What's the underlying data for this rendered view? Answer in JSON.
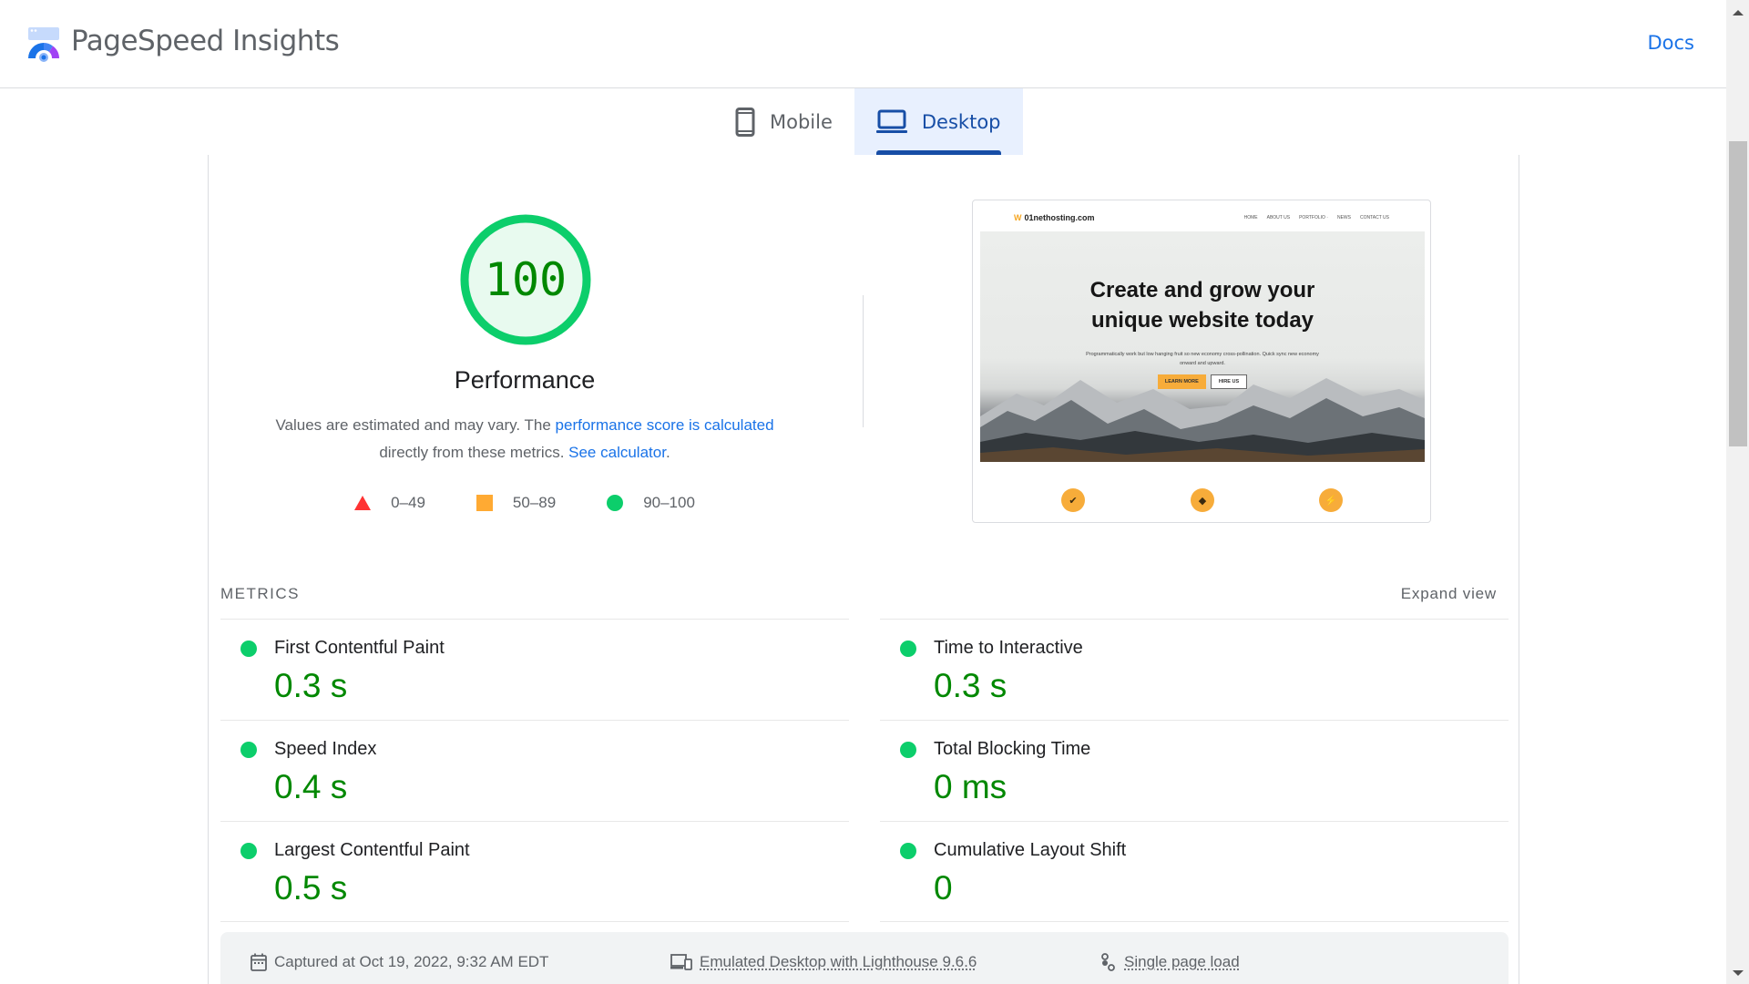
{
  "header": {
    "brand": "PageSpeed Insights",
    "docs_link": "Docs"
  },
  "tabs": [
    {
      "label": "Mobile",
      "icon": "smartphone-icon",
      "active": false
    },
    {
      "label": "Desktop",
      "icon": "laptop-icon",
      "active": true
    }
  ],
  "performance": {
    "score": "100",
    "title": "Performance",
    "desc_prefix": "Values are estimated and may vary. The ",
    "desc_link1": "performance score is calculated",
    "desc_middle": " directly from these metrics. ",
    "desc_link2": "See calculator",
    "desc_suffix": ".",
    "legend": [
      {
        "shape": "triangle",
        "label": "0–49",
        "color": "#ff3333"
      },
      {
        "shape": "square",
        "label": "50–89",
        "color": "#ffaa33"
      },
      {
        "shape": "circle",
        "label": "90–100",
        "color": "#0cce6b"
      }
    ]
  },
  "thumbnail": {
    "site_name": "01nethosting.com",
    "nav_links": [
      "HOME",
      "ABOUT US",
      "PORTFOLIO ·",
      "NEWS",
      "CONTACT US"
    ],
    "headline_line1": "Create and grow your",
    "headline_line2": "unique website today",
    "subtext": "Programmatically work but low hanging fruit so new economy cross-pollination. Quick sync new economy onward and upward.",
    "button_primary": "LEARN MORE",
    "button_secondary": "HIRE US",
    "feature_icons": [
      "✔",
      "◆",
      "⚡"
    ]
  },
  "metrics": {
    "section_label": "METRICS",
    "expand_label": "Expand view",
    "left": [
      {
        "name": "First Contentful Paint",
        "value": "0.3 s",
        "status": "good"
      },
      {
        "name": "Speed Index",
        "value": "0.4 s",
        "status": "good"
      },
      {
        "name": "Largest Contentful Paint",
        "value": "0.5 s",
        "status": "good"
      }
    ],
    "right": [
      {
        "name": "Time to Interactive",
        "value": "0.3 s",
        "status": "good"
      },
      {
        "name": "Total Blocking Time",
        "value": "0 ms",
        "status": "good"
      },
      {
        "name": "Cumulative Layout Shift",
        "value": "0",
        "status": "good"
      }
    ]
  },
  "runtime": {
    "captured": "Captured at Oct 19, 2022, 9:32 AM EDT",
    "emulated": "Emulated Desktop with Lighthouse 9.6.6",
    "load_type": "Single page load"
  },
  "colors": {
    "good": "#0cce6b",
    "good_text": "#008800",
    "link": "#1a73e8",
    "active_tab_bg": "#e8f0fe",
    "active_tab_text": "#174ea6"
  }
}
